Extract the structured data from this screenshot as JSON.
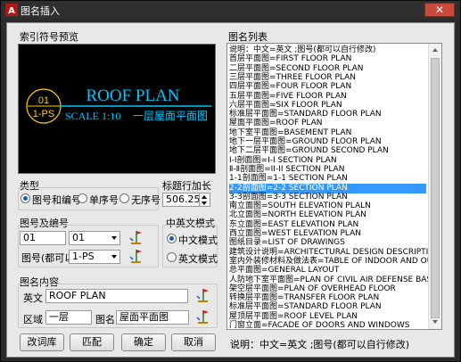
{
  "window": {
    "title": "图名插入",
    "close_glyph": "✕"
  },
  "preview": {
    "label": "索引符号预览",
    "circle_top": "01",
    "circle_bottom": "1-PS",
    "title_en": "ROOF PLAN",
    "scale": "SCALE 1:10",
    "title_cn": "一层屋面平面图",
    "bg_color": "#000000",
    "text_color": "#00c8ff",
    "circle_color": "#ffd000"
  },
  "type_group": {
    "label": "类型",
    "options": [
      {
        "label": "图号和编号",
        "selected": true
      },
      {
        "label": "单序号",
        "selected": false
      },
      {
        "label": "无序号",
        "selected": false
      }
    ]
  },
  "title_row_extend": {
    "label": "标题行加长",
    "value": "506.25"
  },
  "name_number": {
    "label": "图号及编号",
    "number_value": "01",
    "number_combo": "01",
    "drawing_no_label": "图号(都可以",
    "drawing_no_value": "1-PS"
  },
  "lang_mode": {
    "label": "中英文模式",
    "options": [
      {
        "label": "中文模式",
        "selected": true
      },
      {
        "label": "英文模式",
        "selected": false
      }
    ]
  },
  "content": {
    "label": "图名内容",
    "en_label": "英文",
    "en_value": "ROOF PLAN",
    "zone_label": "区域",
    "zone_value": "一层",
    "name_label": "图名",
    "name_value": "屋面平面图"
  },
  "buttons": {
    "modify": "改词库",
    "match": "匹配",
    "ok": "确定",
    "cancel": "取消"
  },
  "list": {
    "label": "图名列表",
    "selected_index": 11,
    "items": [
      "说明：中文=英文 ;图号(都可以自行修改)",
      "首层平面图=FIRST FLOOR PLAN",
      "二层平面图=SECOND FLOOR PLAN",
      "三层平面图=THREE FLOOR PLAN",
      "四层平面图=FOUR FLOOR PLAN",
      "五层平面图=FIVE FLOOR PLAN",
      "六层平面图=SIX FLOOR PLAN",
      "标准层平面图=STANDARD FLOOR PLAN",
      "屋面平面图=ROOF PLAN",
      "地下室平面图=BASEMENT PLAN",
      "地下一层平面图=GROUND FLOOR PLAN",
      "地下二层平面图=GROUND SECOND PLAN",
      "Ⅰ-Ⅰ剖面图=I-I SECTION PLAN",
      "Ⅱ-Ⅱ剖面图=II-II SECTION PLAN",
      "1-1剖面图=1-1 SECTION PLAN",
      "2-2剖面图=2-2 SECTION PLAN",
      "3-3剖面图=3-3 SECTION PLAN",
      "南立面图=SOUTH ELEVATION PLALN",
      "北立面图=NORTH ELEVATION PLAN",
      "东立面图=EAST ELEVATION PLAN",
      "西立面图=WEST ELEVATION PLAN",
      "图纸目录=LIST OF DRAWINGS",
      "建筑设计说明=ARCHITECTURAL DESIGN DESCRIPTION",
      "室内外装修材料及做法表=TABLE OF INDOOR AND OUT",
      "总平面图=GENERAL LAYOUT",
      "人防地下室平面图=PLAN OF CIVIL AIR DEFENSE BASEM",
      "架空层平面图=PLAN OF OVERHEAD FLOOR",
      "转换层平面图=TRANSFER FLOOR PLAN",
      "标准层平面图=STANDARD FLOOR PLAN",
      "屋顶层平面图=ROOF LEVEL PLAN",
      "门窗立面=FACADE OF DOORS AND WINDOWS"
    ]
  },
  "footer_note": "说明：中文=英文 ;图号(都可以自行修改)"
}
